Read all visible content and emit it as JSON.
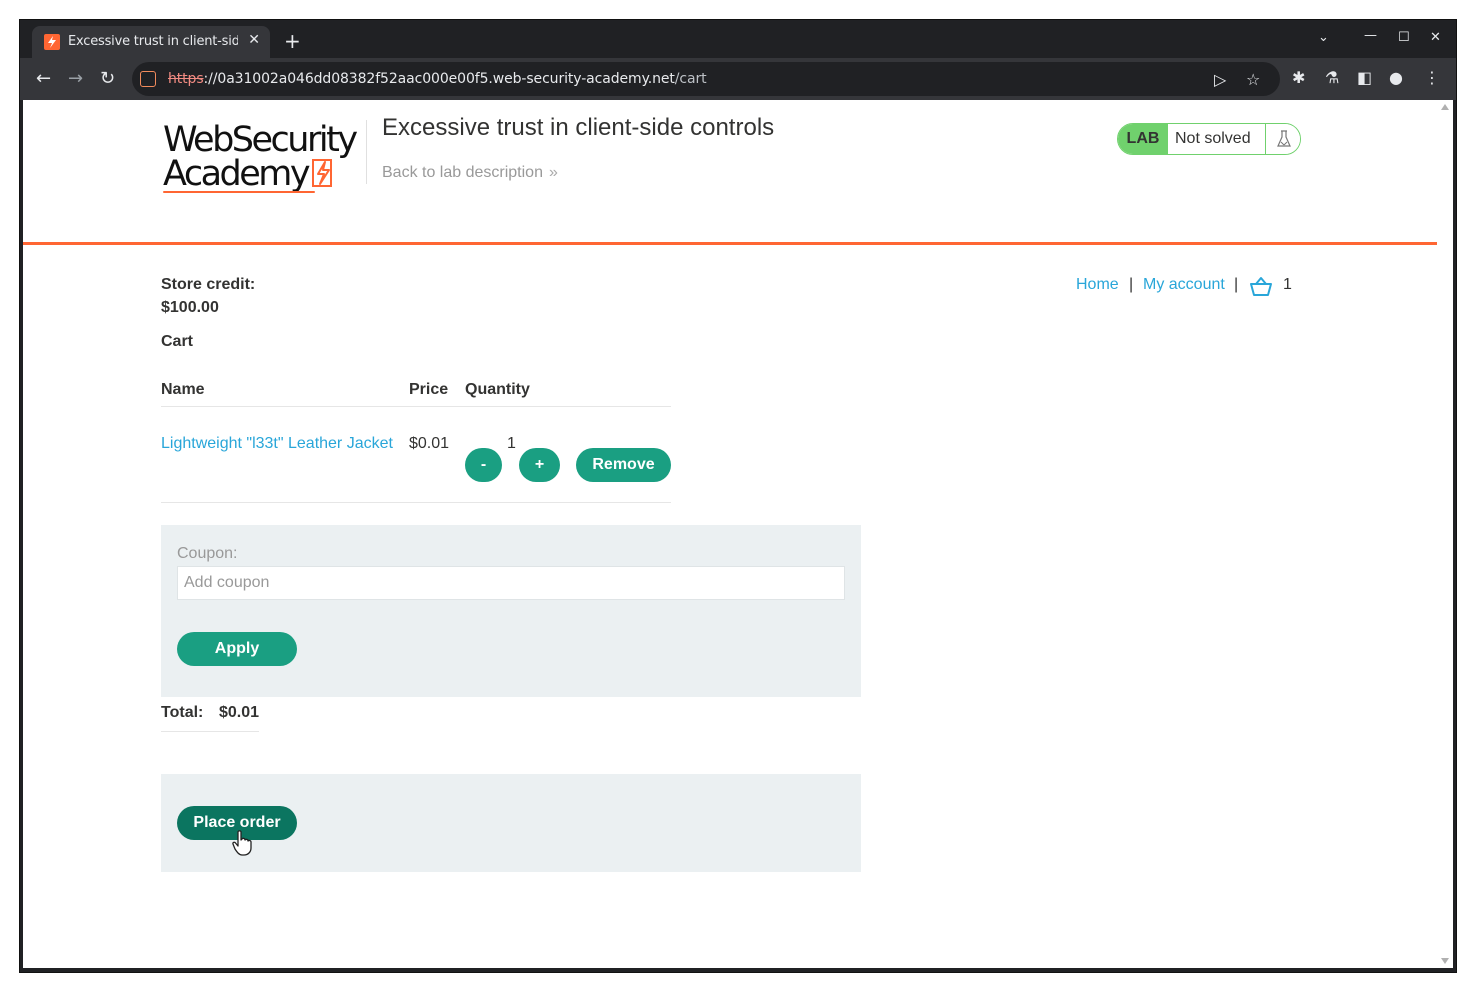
{
  "browser": {
    "tab_title": "Excessive trust in client-side",
    "tab_close": "✕",
    "new_tab": "+",
    "url_scheme": "https",
    "url_rest_host": "://0a31002a046dd08382f52aac000e00f5.web-security-academy.net",
    "url_path": "/cart",
    "icons": [
      "back-icon",
      "forward-icon",
      "reload-icon",
      "site-info-icon",
      "send-icon",
      "star-icon",
      "extensions-icon",
      "labs-icon",
      "sidepanel-icon",
      "profile-icon",
      "menu-icon",
      "chevron-down-icon",
      "minimize-icon",
      "maximize-icon",
      "close-icon"
    ]
  },
  "header": {
    "logo_line1": "WebSecurity",
    "logo_line2": "Academy",
    "lab_title": "Excessive trust in client-side controls",
    "back_link": "Back to lab description",
    "back_chevrons": "»",
    "badge_label": "LAB",
    "badge_status": "Not solved",
    "accent_color": "#ff6633",
    "badge_color": "#70d16d"
  },
  "nav": {
    "home": "Home",
    "sep": "|",
    "my_account": "My account",
    "cart_count": "1"
  },
  "store": {
    "credit_label": "Store credit:",
    "credit_value": "$100.00",
    "cart_heading": "Cart"
  },
  "cart_table": {
    "headers": [
      "Name",
      "Price",
      "Quantity"
    ],
    "rows": [
      {
        "name": "Lightweight \"l33t\" Leather Jacket",
        "price": "$0.01",
        "quantity": "1"
      }
    ],
    "minus_label": "-",
    "plus_label": "+",
    "remove_label": "Remove",
    "button_color": "#1a9f82"
  },
  "coupon": {
    "label": "Coupon:",
    "placeholder": "Add coupon",
    "apply_label": "Apply"
  },
  "totals": {
    "label": "Total:",
    "value": "$0.01"
  },
  "order": {
    "place_order_label": "Place order"
  }
}
